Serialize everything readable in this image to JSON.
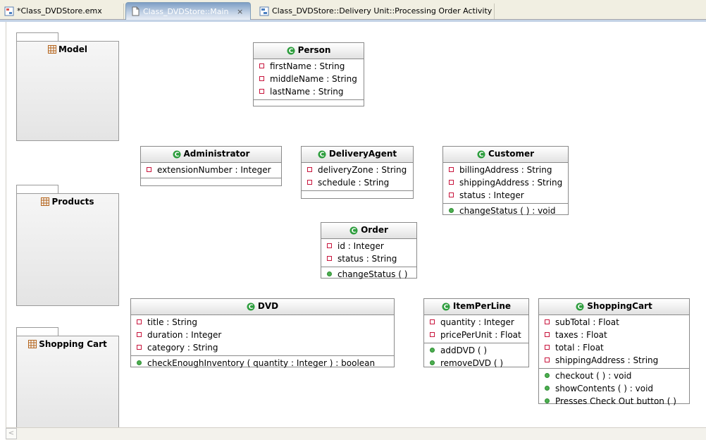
{
  "tabs": [
    {
      "label": "*Class_DVDStore.emx",
      "icon": "model-file-icon",
      "active": false
    },
    {
      "label": "Class_DVDStore::Main",
      "icon": "diagram-file-icon",
      "active": true,
      "close": "×"
    },
    {
      "label": "Class_DVDStore::Delivery Unit::Processing Order Activity",
      "icon": "activity-diagram-icon",
      "active": false
    }
  ],
  "packages": [
    {
      "name": "Model",
      "icon": "package-icon"
    },
    {
      "name": "Products",
      "icon": "package-icon"
    },
    {
      "name": "Shopping Cart",
      "icon": "package-icon"
    }
  ],
  "classes": {
    "person": {
      "name": "Person",
      "attributes": [
        "firstName : String",
        "middleName : String",
        "lastName : String"
      ],
      "operations": []
    },
    "administrator": {
      "name": "Administrator",
      "attributes": [
        "extensionNumber : Integer"
      ],
      "operations": []
    },
    "delivery_agent": {
      "name": "DeliveryAgent",
      "attributes": [
        "deliveryZone : String",
        "schedule : String"
      ],
      "operations": []
    },
    "customer": {
      "name": "Customer",
      "attributes": [
        "billingAddress : String",
        "shippingAddress : String",
        "status : Integer"
      ],
      "operations": [
        "changeStatus ( ) : void"
      ]
    },
    "order": {
      "name": "Order",
      "attributes": [
        "id : Integer",
        "status : String"
      ],
      "operations": [
        "changeStatus ( )"
      ]
    },
    "dvd": {
      "name": "DVD",
      "attributes": [
        "title : String",
        "duration : Integer",
        "category : String"
      ],
      "operations": [
        "checkEnoughInventory ( quantity : Integer ) : boolean"
      ]
    },
    "item_per_line": {
      "name": "ItemPerLine",
      "attributes": [
        "quantity : Integer",
        "pricePerUnit : Float"
      ],
      "operations": [
        "addDVD ( )",
        "removeDVD ( )"
      ]
    },
    "shopping_cart": {
      "name": "ShoppingCart",
      "attributes": [
        "subTotal : Float",
        "taxes : Float",
        "total : Float",
        "shippingAddress : String"
      ],
      "operations": [
        "checkout ( ) : void",
        "showContents ( ) : void",
        "Presses Check Out button ( )"
      ]
    }
  },
  "colors": {
    "class_icon": "#2e9e3e",
    "attribute_marker": "#c8143c",
    "operation_marker": "#4caf50",
    "package_icon": "#b5651d"
  }
}
